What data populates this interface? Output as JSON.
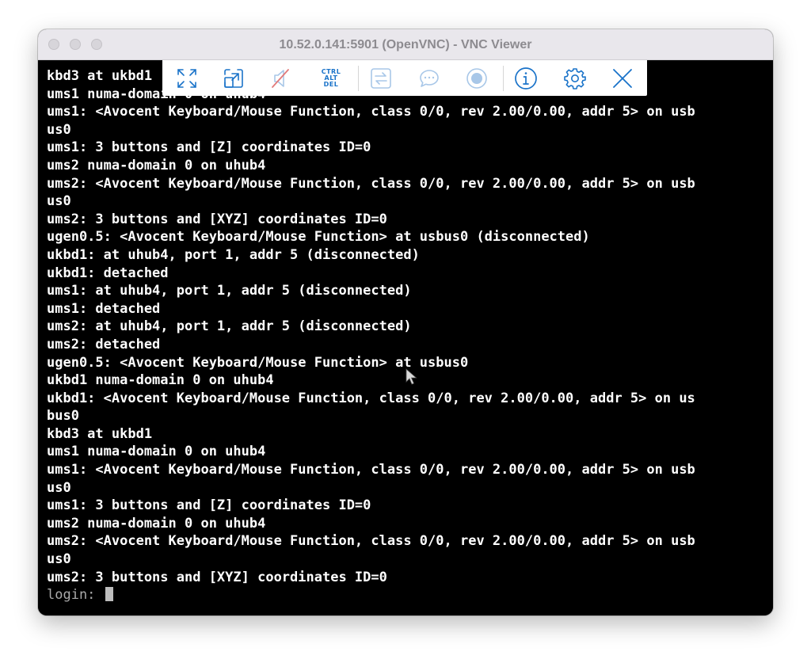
{
  "window": {
    "title": "10.52.0.141:5901 (OpenVNC) - VNC Viewer"
  },
  "toolbar": {
    "cad_line1": "CTRL",
    "cad_line2": "ALT",
    "cad_line3": "DEL",
    "icons": [
      "fullscreen-icon",
      "scale-icon",
      "mute-icon",
      "ctrl-alt-del-icon",
      "transfer-icon",
      "chat-icon",
      "record-icon",
      "info-icon",
      "settings-icon",
      "close-icon"
    ],
    "accent_color": "#1a73c9",
    "disabled_color": "#a8c7e8"
  },
  "console": {
    "lines": [
      "kbd3 at ukbd1",
      "ums1 numa-domain 0 on uhub4",
      "ums1: <Avocent Keyboard/Mouse Function, class 0/0, rev 2.00/0.00, addr 5> on usb",
      "us0",
      "ums1: 3 buttons and [Z] coordinates ID=0",
      "ums2 numa-domain 0 on uhub4",
      "ums2: <Avocent Keyboard/Mouse Function, class 0/0, rev 2.00/0.00, addr 5> on usb",
      "us0",
      "ums2: 3 buttons and [XYZ] coordinates ID=0",
      "ugen0.5: <Avocent Keyboard/Mouse Function> at usbus0 (disconnected)",
      "ukbd1: at uhub4, port 1, addr 5 (disconnected)",
      "ukbd1: detached",
      "ums1: at uhub4, port 1, addr 5 (disconnected)",
      "ums1: detached",
      "ums2: at uhub4, port 1, addr 5 (disconnected)",
      "ums2: detached",
      "ugen0.5: <Avocent Keyboard/Mouse Function> at usbus0",
      "ukbd1 numa-domain 0 on uhub4",
      "ukbd1: <Avocent Keyboard/Mouse Function, class 0/0, rev 2.00/0.00, addr 5> on us",
      "bus0",
      "kbd3 at ukbd1",
      "ums1 numa-domain 0 on uhub4",
      "ums1: <Avocent Keyboard/Mouse Function, class 0/0, rev 2.00/0.00, addr 5> on usb",
      "us0",
      "ums1: 3 buttons and [Z] coordinates ID=0",
      "ums2 numa-domain 0 on uhub4",
      "ums2: <Avocent Keyboard/Mouse Function, class 0/0, rev 2.00/0.00, addr 5> on usb",
      "us0",
      "ums2: 3 buttons and [XYZ] coordinates ID=0"
    ],
    "prompt": "login: "
  }
}
